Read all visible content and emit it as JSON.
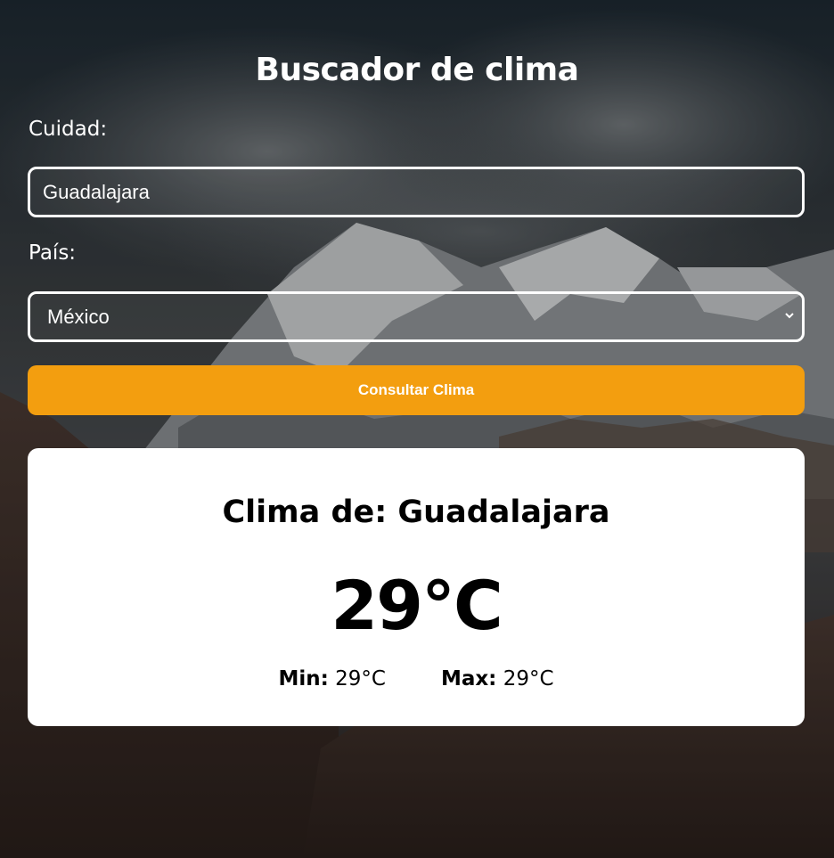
{
  "header": {
    "title": "Buscador de clima"
  },
  "form": {
    "city_label": "Cuidad:",
    "city_value": "Guadalajara",
    "country_label": "País:",
    "country_selected": "México",
    "submit_label": "Consultar Clima"
  },
  "result": {
    "title": "Clima de: Guadalajara",
    "temperature": "29°C",
    "min_label": "Min:",
    "min_value": "29°C",
    "max_label": "Max:",
    "max_value": "29°C"
  },
  "colors": {
    "accent": "#f39e0f",
    "card_bg": "#ffffff",
    "text_light": "#ffffff",
    "text_dark": "#000000"
  },
  "icons": {
    "select_arrow": "chevron-down-icon"
  }
}
